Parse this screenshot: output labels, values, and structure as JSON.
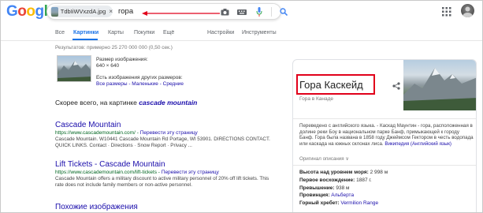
{
  "header": {
    "logo_letters": [
      {
        "ch": "G",
        "color": "#4285f4"
      },
      {
        "ch": "o",
        "color": "#ea4335"
      },
      {
        "ch": "o",
        "color": "#fbbc05"
      },
      {
        "ch": "g",
        "color": "#4285f4"
      },
      {
        "ch": "l",
        "color": "#34a853"
      },
      {
        "ch": "e",
        "color": "#ea4335"
      }
    ],
    "chip_filename": "TdbIiWVxzdA.jpg",
    "chip_close": "×",
    "query": "гора",
    "annotation_arrow_color": "#e1001a"
  },
  "tabs": [
    {
      "label": "Все",
      "active": false
    },
    {
      "label": "Картинки",
      "active": true
    },
    {
      "label": "Карты",
      "active": false
    },
    {
      "label": "Покупки",
      "active": false
    },
    {
      "label": "Ещё",
      "active": false
    },
    {
      "label": "Настройки",
      "active": false
    },
    {
      "label": "Инструменты",
      "active": false
    }
  ],
  "stats": "Результатов: примерно 25 270 000 000 (0,50 сек.)",
  "image_info": {
    "size_label": "Размер изображения:",
    "size_value": "640 × 640",
    "other_sizes_label": "Есть изображения других размеров:",
    "sizes_links": "Все размеры - Маленькие - Средние"
  },
  "best_guess": {
    "prefix": "Скорее всего, на картинке",
    "term": "cascade mountain"
  },
  "results": [
    {
      "title": "Cascade Mountain",
      "url": "https://www.cascademountain.com/",
      "translate": "Перевести эту страницу",
      "snippet": "Cascade Mountain. W10441 Cascade Mountain Rd Portage, WI 53901. DIRECTIONS CONTACT. QUICK LINKS. Contact · Directions · Snow Report · Privacy ..."
    },
    {
      "title": "Lift Tickets - Cascade Mountain",
      "url": "https://www.cascademountain.com/lift-tickets",
      "translate": "Перевести эту страницу",
      "snippet": "Cascade Mountain offers a military discount to active military personnel of 20% off lift tickets. This rate does not include family members or non-active personnel."
    }
  ],
  "similar_heading": "Похожие изображения",
  "knowledge_panel": {
    "title": "Гора Каскейд",
    "subtitle": "Гора в Канаде",
    "description": "Переведено с английского языка. - Каскад Маунтин - гора, расположенная в долине реки Боу в национальном парке Банф, примыкающей к городу Банф. Гора была названа в 1858 году Джеймсом Гектором в честь водопада или каскада на южных склонах лиса.",
    "desc_link": "Википедия (Английский язык)",
    "original_label": "Оригинал описания ∨",
    "facts": [
      {
        "label": "Высота над уровнем моря:",
        "value": "2 998 м",
        "link": false
      },
      {
        "label": "Первое восхождение:",
        "value": "1887 г.",
        "link": false
      },
      {
        "label": "Превышение:",
        "value": "938 м",
        "link": false
      },
      {
        "label": "Провинция:",
        "value": "Альберта",
        "link": true
      },
      {
        "label": "Горный хребет:",
        "value": "Vermilion Range",
        "link": true
      }
    ],
    "highlight_color": "#e1001a"
  }
}
